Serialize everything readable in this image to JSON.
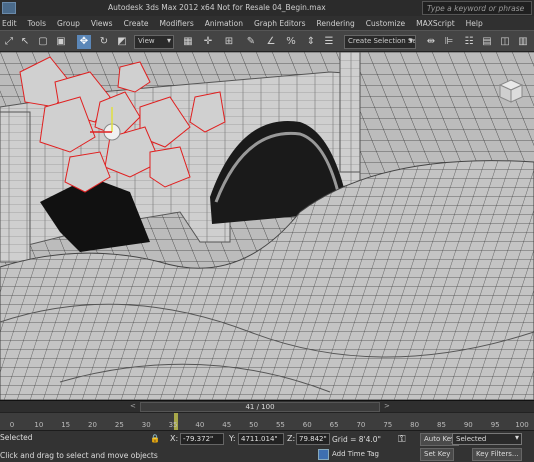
{
  "window": {
    "title": "Autodesk 3ds Max 2012 x64    Not for Resale    04_Begin.max",
    "search_placeholder": "Type a keyword or phrase"
  },
  "menu": [
    "Edit",
    "Tools",
    "Group",
    "Views",
    "Create",
    "Modifiers",
    "Animation",
    "Graph Editors",
    "Rendering",
    "Customize",
    "MAXScript",
    "Help"
  ],
  "toolbar": {
    "reference_coord": "View",
    "named_selection": "Create Selection Set",
    "active_tool": "select-and-move"
  },
  "timeline": {
    "frame_counter": "41 / 100",
    "current_frame": 41,
    "total_frames": 100,
    "ticks": [
      "0",
      "10",
      "15",
      "20",
      "25",
      "30",
      "35",
      "40",
      "45",
      "50",
      "55",
      "60",
      "65",
      "70",
      "75",
      "80",
      "85",
      "90",
      "95",
      "100"
    ]
  },
  "status": {
    "selection": "Selected",
    "prompt": "Click and drag to select and move objects",
    "x_label": "X:",
    "x_value": "-79.372\"",
    "y_label": "Y:",
    "y_value": "4711.014\"",
    "z_label": "Z:",
    "z_value": "79.842\"",
    "grid": "Grid = 8'4.0\"",
    "add_time_tag": "Add Time Tag",
    "auto_key": "Auto Key",
    "set_key": "Set Key",
    "key_mode_selected": "Selected",
    "key_filters": "Key Filters..."
  },
  "colors": {
    "viewport_bg": "#bdbdbd",
    "selection_highlight": "#e02020",
    "active_tool": "#5b87b8"
  }
}
